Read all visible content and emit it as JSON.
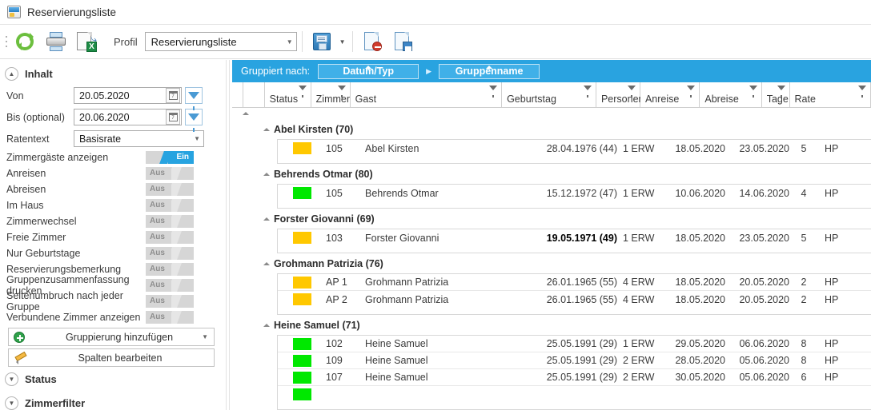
{
  "window": {
    "title": "Reservierungsliste",
    "icon": "report-window-icon"
  },
  "toolbar": {
    "refresh_tooltip": "Aktualisieren",
    "print_tooltip": "Drucken",
    "export_tooltip": "Export",
    "save_tooltip": "Speichern",
    "delete_tooltip": "Profil löschen",
    "saveas_tooltip": "Profil speichern unter",
    "profil_label": "Profil",
    "profil_value": "Reservierungsliste"
  },
  "sidebar": {
    "section_inhalt": "Inhalt",
    "fields": [
      {
        "label": "Von",
        "value": "20.05.2020"
      },
      {
        "label": "Bis (optional)",
        "value": "20.06.2020"
      }
    ],
    "ratentext_label": "Ratentext",
    "ratentext_value": "Basisrate",
    "toggles": [
      {
        "label": "Zimmergäste anzeigen",
        "state": "Ein",
        "on": true
      },
      {
        "label": "Anreisen",
        "state": "Aus",
        "on": false
      },
      {
        "label": "Abreisen",
        "state": "Aus",
        "on": false
      },
      {
        "label": "Im Haus",
        "state": "Aus",
        "on": false
      },
      {
        "label": "Zimmerwechsel",
        "state": "Aus",
        "on": false
      },
      {
        "label": "Freie Zimmer",
        "state": "Aus",
        "on": false
      },
      {
        "label": "Nur Geburtstage",
        "state": "Aus",
        "on": false
      },
      {
        "label": "Reservierungsbemerkung",
        "state": "Aus",
        "on": false
      },
      {
        "label": "Gruppenzusammenfassung drucken",
        "state": "Aus",
        "on": false
      },
      {
        "label": "Seitenumbruch nach jeder Gruppe",
        "state": "Aus",
        "on": false
      },
      {
        "label": "Verbundene Zimmer anzeigen",
        "state": "Aus",
        "on": false
      }
    ],
    "add_grouping_label": "Gruppierung hinzufügen",
    "edit_columns_label": "Spalten bearbeiten",
    "section_status": "Status",
    "section_zimmerfilter": "Zimmerfilter"
  },
  "grid": {
    "groupbar_label": "Gruppiert nach:",
    "group_chips": [
      "Datum/Typ",
      "Gruppenname"
    ],
    "columns": [
      {
        "key": "status",
        "label": "Status"
      },
      {
        "key": "zimmer",
        "label": "Zimmer"
      },
      {
        "key": "gast",
        "label": "Gast"
      },
      {
        "key": "geburtstag",
        "label": "Geburtstag"
      },
      {
        "key": "personen",
        "label": "Personen"
      },
      {
        "key": "anreise",
        "label": "Anreise"
      },
      {
        "key": "abreise",
        "label": "Abreise"
      },
      {
        "key": "tage",
        "label": "Tage"
      },
      {
        "key": "rate",
        "label": "Rate"
      }
    ],
    "groups": [
      {
        "title": "Abel Kirsten (70)",
        "rows": [
          {
            "status_color": "#ffc800",
            "zimmer": "105",
            "gast": "Abel Kirsten",
            "geburtstag": "28.04.1976",
            "alter": "(44)",
            "geb_bold": false,
            "personen": "1 ERW",
            "anreise": "18.05.2020",
            "abreise": "23.05.2020",
            "tage": "5",
            "rate": "HP"
          }
        ]
      },
      {
        "title": "Behrends Otmar (80)",
        "rows": [
          {
            "status_color": "#00e800",
            "zimmer": "105",
            "gast": "Behrends Otmar",
            "geburtstag": "15.12.1972",
            "alter": "(47)",
            "geb_bold": false,
            "personen": "1 ERW",
            "anreise": "10.06.2020",
            "abreise": "14.06.2020",
            "tage": "4",
            "rate": "HP"
          }
        ]
      },
      {
        "title": "Forster Giovanni (69)",
        "rows": [
          {
            "status_color": "#ffc800",
            "zimmer": "103",
            "gast": "Forster Giovanni",
            "geburtstag": "19.05.1971",
            "alter": "(49)",
            "geb_bold": true,
            "personen": "1 ERW",
            "anreise": "18.05.2020",
            "abreise": "23.05.2020",
            "tage": "5",
            "rate": "HP"
          }
        ]
      },
      {
        "title": "Grohmann Patrizia (76)",
        "rows": [
          {
            "status_color": "#ffc800",
            "zimmer": "AP 1",
            "gast": "Grohmann Patrizia",
            "geburtstag": "26.01.1965",
            "alter": "(55)",
            "geb_bold": false,
            "personen": "4 ERW",
            "anreise": "18.05.2020",
            "abreise": "20.05.2020",
            "tage": "2",
            "rate": "HP"
          },
          {
            "status_color": "#ffc800",
            "zimmer": "AP 2",
            "gast": "Grohmann Patrizia",
            "geburtstag": "26.01.1965",
            "alter": "(55)",
            "geb_bold": false,
            "personen": "4 ERW",
            "anreise": "18.05.2020",
            "abreise": "20.05.2020",
            "tage": "2",
            "rate": "HP"
          }
        ]
      },
      {
        "title": "Heine Samuel (71)",
        "rows": [
          {
            "status_color": "#00e800",
            "zimmer": "102",
            "gast": "Heine Samuel",
            "geburtstag": "25.05.1991",
            "alter": "(29)",
            "geb_bold": false,
            "personen": "1 ERW",
            "anreise": "29.05.2020",
            "abreise": "06.06.2020",
            "tage": "8",
            "rate": "HP"
          },
          {
            "status_color": "#00e800",
            "zimmer": "109",
            "gast": "Heine Samuel",
            "geburtstag": "25.05.1991",
            "alter": "(29)",
            "geb_bold": false,
            "personen": "2 ERW",
            "anreise": "28.05.2020",
            "abreise": "05.06.2020",
            "tage": "8",
            "rate": "HP"
          },
          {
            "status_color": "#00e800",
            "zimmer": "107",
            "gast": "Heine Samuel",
            "geburtstag": "25.05.1991",
            "alter": "(29)",
            "geb_bold": false,
            "personen": "2 ERW",
            "anreise": "30.05.2020",
            "abreise": "05.06.2020",
            "tage": "6",
            "rate": "HP"
          },
          {
            "status_color": "#00e800",
            "zimmer": "",
            "gast": "",
            "geburtstag": "",
            "alter": "",
            "geb_bold": false,
            "personen": "",
            "anreise": "",
            "abreise": "",
            "tage": "",
            "rate": ""
          }
        ]
      }
    ]
  },
  "colors": {
    "accent": "#29a3e0",
    "chip": "#40b0e8",
    "status_yellow": "#ffc800",
    "status_green": "#00e800",
    "toggle_on": "#27a3e0",
    "toggle_off": "#d6d6d6"
  }
}
